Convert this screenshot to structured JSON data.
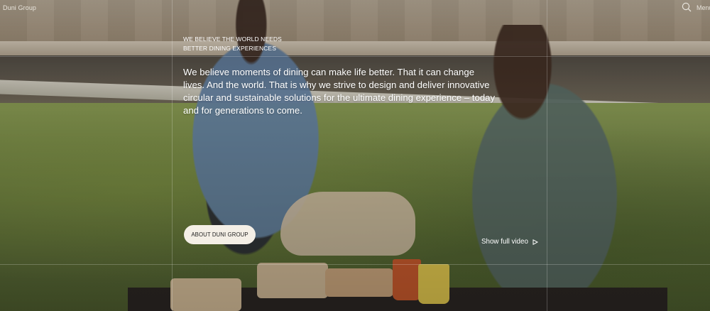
{
  "header": {
    "brand": "Duni Group",
    "menu_label": "Menu"
  },
  "hero": {
    "eyebrow": "WE BELIEVE THE WORLD NEEDS BETTER DINING EXPERIENCES",
    "lead": "We believe moments of dining can make life better. That it can change lives. And the world. That is why we strive to design and deliver innovative circular and sustainable solutions for the ultimate dining experience – today and for generations to come.",
    "cta_label": "ABOUT DUNI GROUP",
    "video_label": "Show full video"
  },
  "icons": {
    "search": "search-icon",
    "play": "play-icon"
  }
}
